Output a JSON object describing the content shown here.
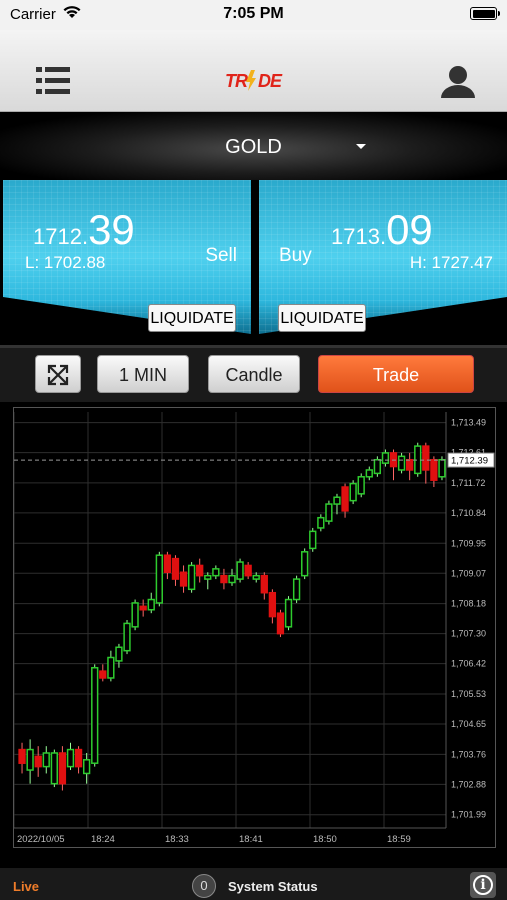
{
  "status_bar": {
    "carrier": "Carrier",
    "time": "7:05 PM"
  },
  "header": {
    "logo_text": "TRNDE",
    "logo_color": "#e0241a"
  },
  "symbol": {
    "name": "GOLD"
  },
  "sell": {
    "price_small": "1712.",
    "price_big": "39",
    "side": "Sell",
    "low_label": "L: 1702.88",
    "liquidate": "LIQUIDATE"
  },
  "buy": {
    "price_small": "1713.",
    "price_big": "09",
    "side": "Buy",
    "high_label": "H: 1727.47",
    "liquidate": "LIQUIDATE"
  },
  "toolbar": {
    "interval": "1 MIN",
    "chart_type": "Candle",
    "trade": "Trade"
  },
  "footer": {
    "live": "Live",
    "status_count": "0",
    "status_label": "System Status"
  },
  "colors": {
    "up": "#2ecc2e",
    "down": "#e01010",
    "accent": "#f07d2a",
    "quote_blue": "#4fd0ee"
  },
  "chart_data": {
    "type": "candlestick",
    "ylim": [
      1701.6,
      1713.8
    ],
    "y_ticks": [
      "1,713.49",
      "1,712.61",
      "1,711.72",
      "1,710.84",
      "1,709.95",
      "1,709.07",
      "1,708.18",
      "1,707.30",
      "1,706.42",
      "1,705.53",
      "1,704.65",
      "1,703.76",
      "1,702.88",
      "1,701.99"
    ],
    "y_tick_values": [
      1713.49,
      1712.61,
      1711.72,
      1710.84,
      1709.95,
      1709.07,
      1708.18,
      1707.3,
      1706.42,
      1705.53,
      1704.65,
      1703.76,
      1702.88,
      1701.99
    ],
    "x_labels": [
      "2022/10/05",
      "18:24",
      "18:33",
      "18:41",
      "18:50",
      "18:59"
    ],
    "last_price": 1712.39,
    "last_price_label": "1,712.39",
    "candles": [
      {
        "o": 1703.9,
        "c": 1703.5,
        "h": 1704.1,
        "l": 1703.2
      },
      {
        "o": 1703.3,
        "c": 1703.9,
        "h": 1704.2,
        "l": 1702.9
      },
      {
        "o": 1703.7,
        "c": 1703.4,
        "h": 1704.0,
        "l": 1703.1
      },
      {
        "o": 1703.4,
        "c": 1703.8,
        "h": 1704.0,
        "l": 1703.2
      },
      {
        "o": 1702.9,
        "c": 1703.8,
        "h": 1703.9,
        "l": 1702.8
      },
      {
        "o": 1703.8,
        "c": 1702.9,
        "h": 1704.0,
        "l": 1702.7
      },
      {
        "o": 1703.4,
        "c": 1703.9,
        "h": 1704.1,
        "l": 1703.3
      },
      {
        "o": 1703.9,
        "c": 1703.4,
        "h": 1704.0,
        "l": 1703.2
      },
      {
        "o": 1703.2,
        "c": 1703.6,
        "h": 1703.8,
        "l": 1702.9
      },
      {
        "o": 1703.5,
        "c": 1706.3,
        "h": 1706.4,
        "l": 1703.4
      },
      {
        "o": 1706.2,
        "c": 1706.0,
        "h": 1706.4,
        "l": 1705.9
      },
      {
        "o": 1706.0,
        "c": 1706.6,
        "h": 1706.8,
        "l": 1705.9
      },
      {
        "o": 1706.5,
        "c": 1706.9,
        "h": 1707.0,
        "l": 1706.3
      },
      {
        "o": 1706.8,
        "c": 1707.6,
        "h": 1707.7,
        "l": 1706.7
      },
      {
        "o": 1707.5,
        "c": 1708.2,
        "h": 1708.3,
        "l": 1707.4
      },
      {
        "o": 1708.1,
        "c": 1708.0,
        "h": 1708.3,
        "l": 1707.8
      },
      {
        "o": 1708.0,
        "c": 1708.3,
        "h": 1708.5,
        "l": 1707.9
      },
      {
        "o": 1708.2,
        "c": 1709.6,
        "h": 1709.7,
        "l": 1708.1
      },
      {
        "o": 1709.6,
        "c": 1709.1,
        "h": 1709.7,
        "l": 1708.9
      },
      {
        "o": 1709.5,
        "c": 1708.9,
        "h": 1709.6,
        "l": 1708.7
      },
      {
        "o": 1709.1,
        "c": 1708.7,
        "h": 1709.3,
        "l": 1708.5
      },
      {
        "o": 1708.6,
        "c": 1709.3,
        "h": 1709.4,
        "l": 1708.5
      },
      {
        "o": 1709.3,
        "c": 1709.0,
        "h": 1709.5,
        "l": 1708.8
      },
      {
        "o": 1708.9,
        "c": 1709.0,
        "h": 1709.1,
        "l": 1708.6
      },
      {
        "o": 1709.0,
        "c": 1709.2,
        "h": 1709.3,
        "l": 1708.9
      },
      {
        "o": 1709.0,
        "c": 1708.8,
        "h": 1709.2,
        "l": 1708.6
      },
      {
        "o": 1708.8,
        "c": 1709.0,
        "h": 1709.2,
        "l": 1708.7
      },
      {
        "o": 1708.9,
        "c": 1709.4,
        "h": 1709.5,
        "l": 1708.8
      },
      {
        "o": 1709.3,
        "c": 1709.0,
        "h": 1709.4,
        "l": 1708.9
      },
      {
        "o": 1708.9,
        "c": 1709.0,
        "h": 1709.1,
        "l": 1708.8
      },
      {
        "o": 1709.0,
        "c": 1708.5,
        "h": 1709.1,
        "l": 1708.3
      },
      {
        "o": 1708.5,
        "c": 1707.8,
        "h": 1708.6,
        "l": 1707.6
      },
      {
        "o": 1707.9,
        "c": 1707.3,
        "h": 1708.0,
        "l": 1707.2
      },
      {
        "o": 1707.5,
        "c": 1708.3,
        "h": 1708.4,
        "l": 1707.4
      },
      {
        "o": 1708.3,
        "c": 1708.9,
        "h": 1709.0,
        "l": 1708.2
      },
      {
        "o": 1709.0,
        "c": 1709.7,
        "h": 1709.8,
        "l": 1708.9
      },
      {
        "o": 1709.8,
        "c": 1710.3,
        "h": 1710.4,
        "l": 1709.7
      },
      {
        "o": 1710.4,
        "c": 1710.7,
        "h": 1710.8,
        "l": 1710.3
      },
      {
        "o": 1710.6,
        "c": 1711.1,
        "h": 1711.2,
        "l": 1710.5
      },
      {
        "o": 1711.1,
        "c": 1711.3,
        "h": 1711.4,
        "l": 1710.8
      },
      {
        "o": 1711.6,
        "c": 1710.9,
        "h": 1711.7,
        "l": 1710.7
      },
      {
        "o": 1711.2,
        "c": 1711.7,
        "h": 1711.8,
        "l": 1711.1
      },
      {
        "o": 1711.4,
        "c": 1711.9,
        "h": 1712.0,
        "l": 1711.3
      },
      {
        "o": 1711.9,
        "c": 1712.1,
        "h": 1712.2,
        "l": 1711.8
      },
      {
        "o": 1712.0,
        "c": 1712.4,
        "h": 1712.5,
        "l": 1711.9
      },
      {
        "o": 1712.3,
        "c": 1712.6,
        "h": 1712.7,
        "l": 1712.2
      },
      {
        "o": 1712.6,
        "c": 1712.2,
        "h": 1712.7,
        "l": 1711.8
      },
      {
        "o": 1712.1,
        "c": 1712.5,
        "h": 1712.6,
        "l": 1712.0
      },
      {
        "o": 1712.4,
        "c": 1712.1,
        "h": 1712.6,
        "l": 1711.8
      },
      {
        "o": 1712.0,
        "c": 1712.8,
        "h": 1712.9,
        "l": 1711.9
      },
      {
        "o": 1712.8,
        "c": 1712.1,
        "h": 1712.9,
        "l": 1711.7
      },
      {
        "o": 1712.4,
        "c": 1711.8,
        "h": 1712.5,
        "l": 1711.6
      },
      {
        "o": 1711.9,
        "c": 1712.4,
        "h": 1712.5,
        "l": 1711.8
      }
    ]
  }
}
